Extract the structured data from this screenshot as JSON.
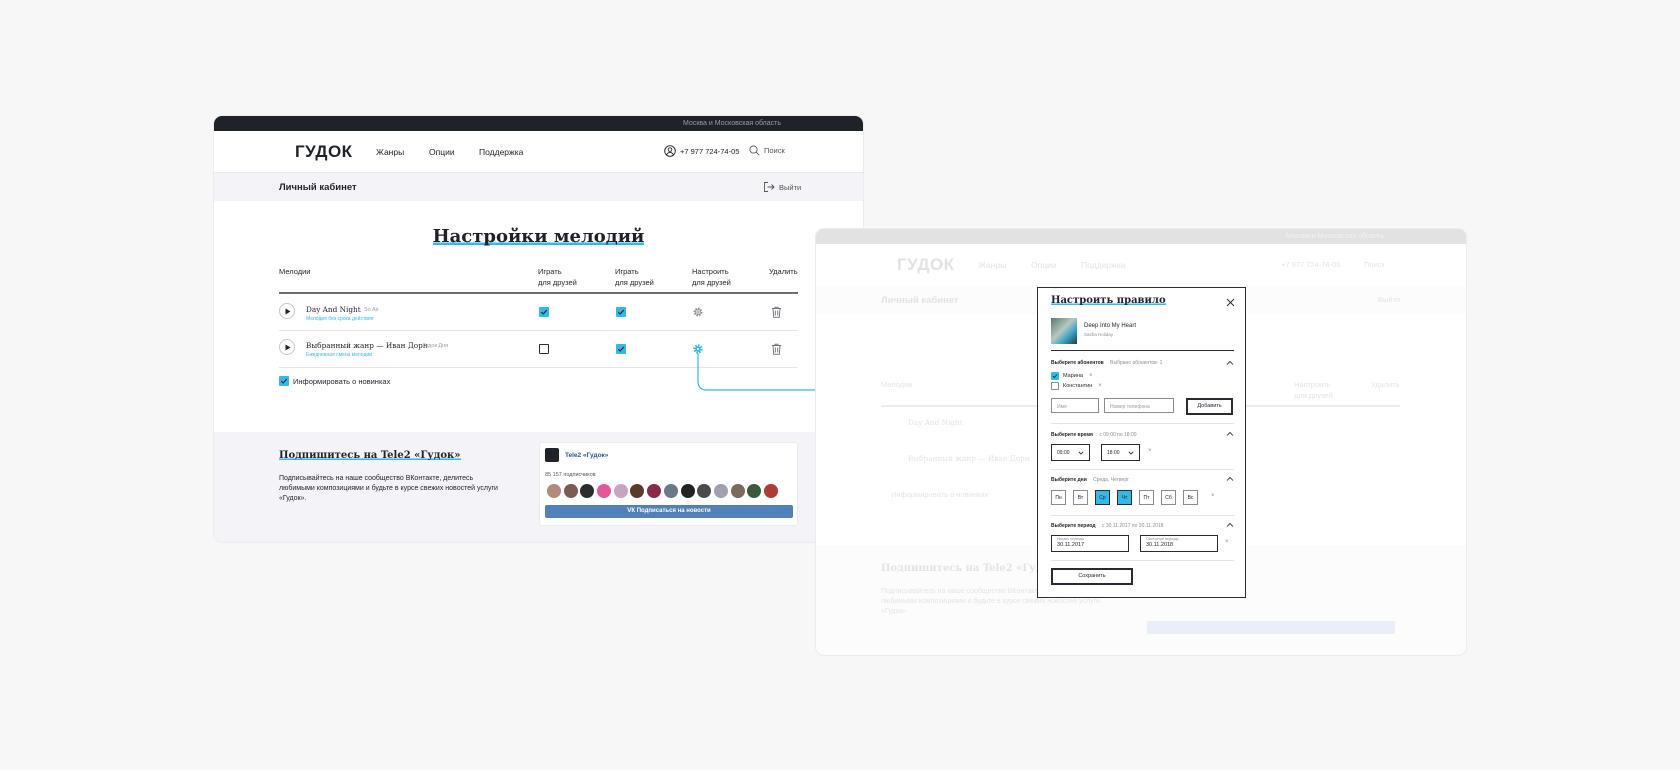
{
  "site": {
    "region": "Москва и Московская область",
    "logo": "ГУДОК",
    "nav": [
      "Жанры",
      "Опции",
      "Поддержка"
    ],
    "phone": "+7 977 724-74-05",
    "search": "Поиск"
  },
  "cabinet": {
    "title": "Личный кабинет",
    "logout": "Выйти"
  },
  "page": {
    "title": "Настройки мелодий",
    "columns": {
      "melodies": "Мелодии",
      "play_friends_1": "Играть",
      "play_friends_2": "для друзей",
      "play_friends_b1": "Играть",
      "play_friends_b2": "для друзей",
      "configure_1": "Настроить",
      "configure_2": "для друзей",
      "delete": "Удалить"
    },
    "tracks": [
      {
        "title": "Day And Night",
        "artist": "So Air",
        "subtitle": "Мелодия без срока действия",
        "col1": true,
        "col2": true,
        "configure_active": false
      },
      {
        "title": "Выбранный жанр — Иван Дорн",
        "artist": "Гудок Дня",
        "subtitle": "Ежедневная смена мелодии",
        "col1": false,
        "col2": true,
        "configure_active": true
      }
    ],
    "notify_label": "Информировать о новинках",
    "notify_checked": true
  },
  "footer": {
    "title": "Подпишитесь на Tele2 «Гудок»",
    "text": "Подписывайтесь на наше сообщество ВКонтакте, делитесь любимыми композициями и будьте в курсе свежих новостей услуги «Гудок».",
    "vk_name": "Tele2 «Гудок»",
    "vk_subs": "85 157 подписчиков",
    "vk_button": "Подписаться на новости",
    "avatar_colors": [
      "#b48a7a",
      "#7a5c52",
      "#2d2d2d",
      "#e05a9a",
      "#c9a4c0",
      "#5a3a2a",
      "#8a2a4a",
      "#6a7a8a",
      "#222222",
      "#4a4a4a",
      "#a0a0b0",
      "#7a6a5a",
      "#3a5a3a",
      "#b03a3a"
    ]
  },
  "modal": {
    "title": "Настроить правило",
    "track_title": "Deep Into My Heart",
    "track_artist": "Sasha Holiday",
    "subscribers": {
      "label": "Выберите абонентов",
      "value": "Выбрано абонентов: 1",
      "list": [
        {
          "name": "Марина",
          "checked": true
        },
        {
          "name": "Константин",
          "checked": false
        }
      ],
      "name_placeholder": "Имя",
      "phone_placeholder": "Номер телефона",
      "add_button": "Добавить"
    },
    "time": {
      "label": "Выберите время",
      "value": "с 09:00 по 18:00",
      "from": "09:00",
      "to": "18:00"
    },
    "days": {
      "label": "Выберите дни",
      "value": "Среда, Четверг",
      "list": [
        {
          "label": "Пн",
          "on": false
        },
        {
          "label": "Вт",
          "on": false
        },
        {
          "label": "Ср",
          "on": true
        },
        {
          "label": "Чт",
          "on": true
        },
        {
          "label": "Пт",
          "on": false
        },
        {
          "label": "Сб",
          "on": false
        },
        {
          "label": "Вс",
          "on": false
        }
      ]
    },
    "period": {
      "label": "Выберите период",
      "value": "с 30.11.2017 по 30.11.2018",
      "start_caption": "Начало периода",
      "start": "30.11.2017",
      "end_caption": "Окончание периода",
      "end": "30.11.2018"
    },
    "save_button": "Сохранить"
  },
  "colors": {
    "accent": "#36b8e6",
    "dark": "#1f2229",
    "vk": "#5181b8"
  }
}
